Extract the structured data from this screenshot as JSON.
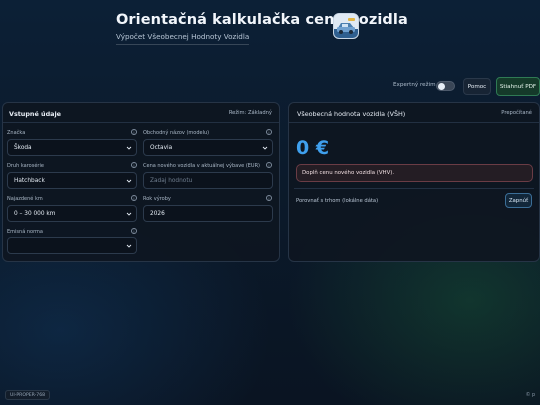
{
  "header": {
    "title": "Orientačná kalkulačka ceny vozidla",
    "subtitle": "Výpočet Všeobecnej Hodnoty Vozidla",
    "logo_icon": "car-logo-icon"
  },
  "toolbar": {
    "expert_mode_label": "Expertný režim",
    "expert_mode_on": false,
    "help_label": "Pomoc",
    "pdf_label": "Stiahnuť PDF"
  },
  "inputs_card": {
    "title": "Vstupné údaje",
    "mode": "Režim: Základný",
    "info_glyph": "i",
    "fields": {
      "brand": {
        "label": "Značka",
        "value": "Škoda"
      },
      "model": {
        "label": "Obchodný názov (modelu)",
        "value": "Octavia"
      },
      "body": {
        "label": "Druh karosérie",
        "value": "Hatchback"
      },
      "new_price": {
        "label": "Cena nového vozidla v aktuálnej výbave (EUR)",
        "placeholder": "Zadaj hodnotu"
      },
      "mileage": {
        "label": "Najazdené km",
        "value": "0 – 30 000 km"
      },
      "year": {
        "label": "Rok výroby",
        "value": "2026"
      },
      "emission": {
        "label": "Emisná norma",
        "value": ""
      }
    }
  },
  "result_card": {
    "title": "Všeobecná hodnota vozidla (VŠH)",
    "status": "Prepočítané",
    "price": "0 €",
    "alert": "Doplň cenu nového vozidla (VHV).",
    "compare_label": "Porovnať s trhom (lokálne dáta)",
    "compare_button": "Zapnúť"
  },
  "footer": {
    "badge": "UI-PROPER-768",
    "copyright": "© p"
  },
  "colors": {
    "accent_blue": "#3fa0ee",
    "pdf_green": "#2f7a54",
    "alert_border": "#6a3c45"
  }
}
